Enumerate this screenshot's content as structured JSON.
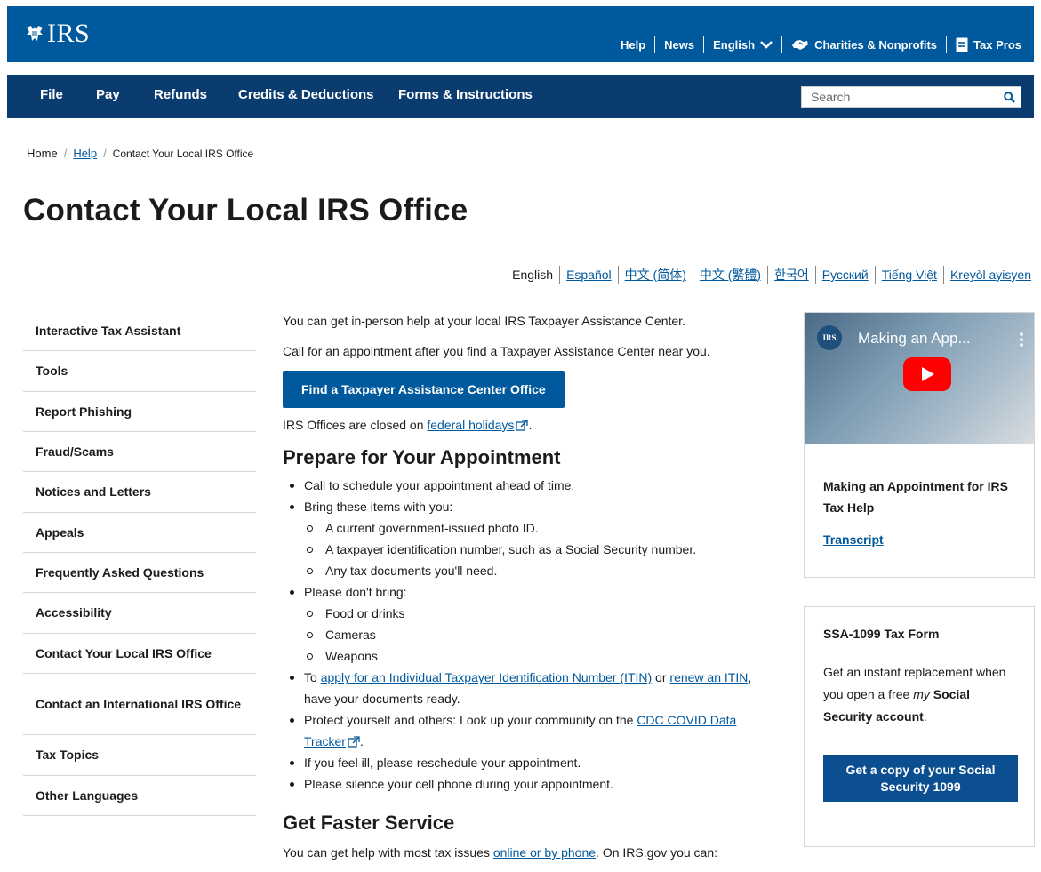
{
  "header": {
    "logo_text": "IRS",
    "utility": {
      "help": "Help",
      "news": "News",
      "language": "English",
      "charities": "Charities & Nonprofits",
      "taxpros": "Tax Pros"
    },
    "nav": [
      "File",
      "Pay",
      "Refunds",
      "Credits & Deductions",
      "Forms & Instructions"
    ],
    "search_placeholder": "Search"
  },
  "breadcrumb": {
    "home": "Home",
    "help": "Help",
    "current": "Contact Your Local IRS Office",
    "separator": "/"
  },
  "page_title": "Contact Your Local IRS Office",
  "languages": [
    "English",
    "Español",
    "中文 (简体)",
    "中文 (繁體)",
    "한국어",
    "Русский",
    "Tiếng Việt",
    "Kreyòl ayisyen"
  ],
  "sidebar": [
    "Interactive Tax Assistant",
    "Tools",
    "Report Phishing",
    "Fraud/Scams",
    "Notices and Letters",
    "Appeals",
    "Frequently Asked Questions",
    "Accessibility",
    "Contact Your Local IRS Office",
    "Contact an International IRS Office",
    "Tax Topics",
    "Other Languages"
  ],
  "main": {
    "intro1": "You can get in-person help at your local IRS Taxpayer Assistance Center.",
    "intro2": "Call for an appointment after you find a Taxpayer Assistance Center near you.",
    "cta": "Find a Taxpayer Assistance Center Office",
    "closed_pre": "IRS Offices are closed on ",
    "closed_link": "federal holidays",
    "closed_post": ".",
    "prepare_heading": "Prepare for Your Appointment",
    "prepare": {
      "call": "Call to schedule your appointment ahead of time.",
      "bring": "Bring these items with you:",
      "bring_items": [
        "A current government-issued photo ID.",
        "A taxpayer identification number, such as a Social Security number.",
        "Any tax documents you'll need."
      ],
      "dont": "Please don't bring:",
      "dont_items": [
        "Food or drinks",
        "Cameras",
        "Weapons"
      ],
      "itin_pre": "To ",
      "itin_link1": "apply for an Individual Taxpayer Identification Number (ITIN)",
      "itin_mid": " or ",
      "itin_link2": "renew an ITIN",
      "itin_post": ", have your documents ready.",
      "protect_pre": "Protect yourself and others: Look up your community on the ",
      "protect_link": "CDC COVID Data Tracker",
      "protect_post": ".",
      "ill": "If you feel ill, please reschedule your appointment.",
      "silence": "Please silence your cell phone during your appointment."
    },
    "faster_heading": "Get Faster Service",
    "faster_pre": "You can get help with most tax issues ",
    "faster_link": "online or by phone",
    "faster_post": ". On IRS.gov you can:"
  },
  "video_card": {
    "video_title": "Making an App...",
    "seal_text": "IRS",
    "title": "Making an Appointment for IRS Tax Help",
    "transcript": "Transcript"
  },
  "ssa_card": {
    "title": "SSA-1099 Tax Form",
    "text_pre": "Get an instant replacement when you open a free ",
    "text_my": "my",
    "text_bold": " Social Security account",
    "text_post": ".",
    "button": "Get a copy of your Social Security 1099"
  },
  "colors": {
    "topbar": "#00599c",
    "navbar": "#0b3c70",
    "link": "#00599c",
    "cta": "#00599c",
    "youtube_red": "#ff0000"
  }
}
